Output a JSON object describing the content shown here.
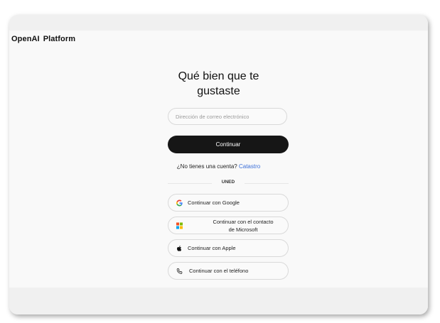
{
  "brand": {
    "name": "OpenAI",
    "product": "Platform"
  },
  "title": {
    "line1": "Qué bien que te",
    "line2": "gustaste"
  },
  "email": {
    "placeholder": "Dirección de correo electrónico",
    "value": ""
  },
  "continue_button": {
    "label": "Continuar"
  },
  "signup": {
    "prompt": "¿No tienes una cuenta?",
    "link": "Catastro"
  },
  "divider": {
    "label": "UNED"
  },
  "providers": [
    {
      "id": "google",
      "icon": "google-icon",
      "label": "Continuar con Google"
    },
    {
      "id": "microsoft",
      "icon": "microsoft-icon",
      "label_line1": "Continuar con el contacto",
      "label_line2": "de Microsoft"
    },
    {
      "id": "apple",
      "icon": "apple-icon",
      "label": "Continuar con Apple"
    },
    {
      "id": "phone",
      "icon": "phone-icon",
      "label": "Continuar con el teléfono"
    }
  ],
  "colors": {
    "button_bg": "#161616",
    "link": "#3b6fd8",
    "page_bg": "#f9f9f9",
    "ms_red": "#f25022",
    "ms_green": "#7fba00",
    "ms_blue": "#00a4ef",
    "ms_yellow": "#ffb900"
  }
}
